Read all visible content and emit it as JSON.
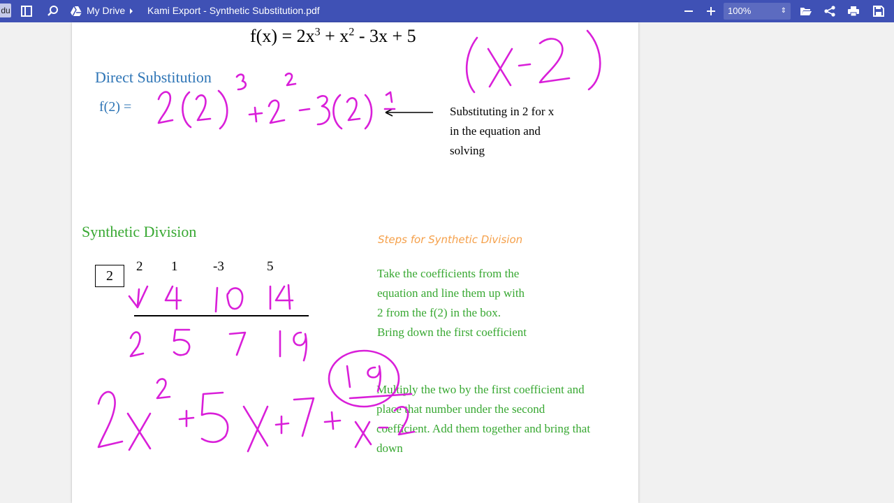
{
  "toolbar": {
    "badge": "du",
    "breadcrumb_root": "My Drive",
    "file_name": "Kami Export - Synthetic Substitution.pdf",
    "zoom": "100%",
    "icons": [
      "sidebar-icon",
      "search-icon",
      "drive-icon",
      "chevron-right-icon",
      "zoom-out-icon",
      "zoom-in-icon",
      "folder-open-icon",
      "share-icon",
      "print-icon",
      "save-icon"
    ],
    "color": "#3f51b5"
  },
  "document": {
    "equation": {
      "prefix": "f(x) = 2x",
      "exp1": "3",
      "mid": " + x",
      "exp2": "2",
      "suffix": " - 3x + 5"
    },
    "direct_substitution": {
      "heading": "Direct Substitution",
      "label": "f(2) =",
      "note_lines": [
        "Substituting in 2 for x",
        "in the equation and",
        "solving"
      ],
      "color": "#2e75b6"
    },
    "synthetic_division": {
      "heading": "Synthetic Division",
      "box_value": "2",
      "coefficients": [
        "2",
        "1",
        "-3",
        "5"
      ],
      "color": "#38a832"
    },
    "steps": {
      "title": "Steps for Synthetic Division",
      "title_color": "#f5a04a",
      "step1_lines": [
        "Take the coefficients from the",
        "equation and line them up with",
        "2 from the f(2) in the box.",
        "Bring down the first coefficient"
      ],
      "step2_lines": [
        "Multiply the two by the first coefficient and",
        "place that number under the second",
        "coefficient. Add them together and bring that",
        "down"
      ]
    },
    "ink_color": "#d91fd9"
  }
}
